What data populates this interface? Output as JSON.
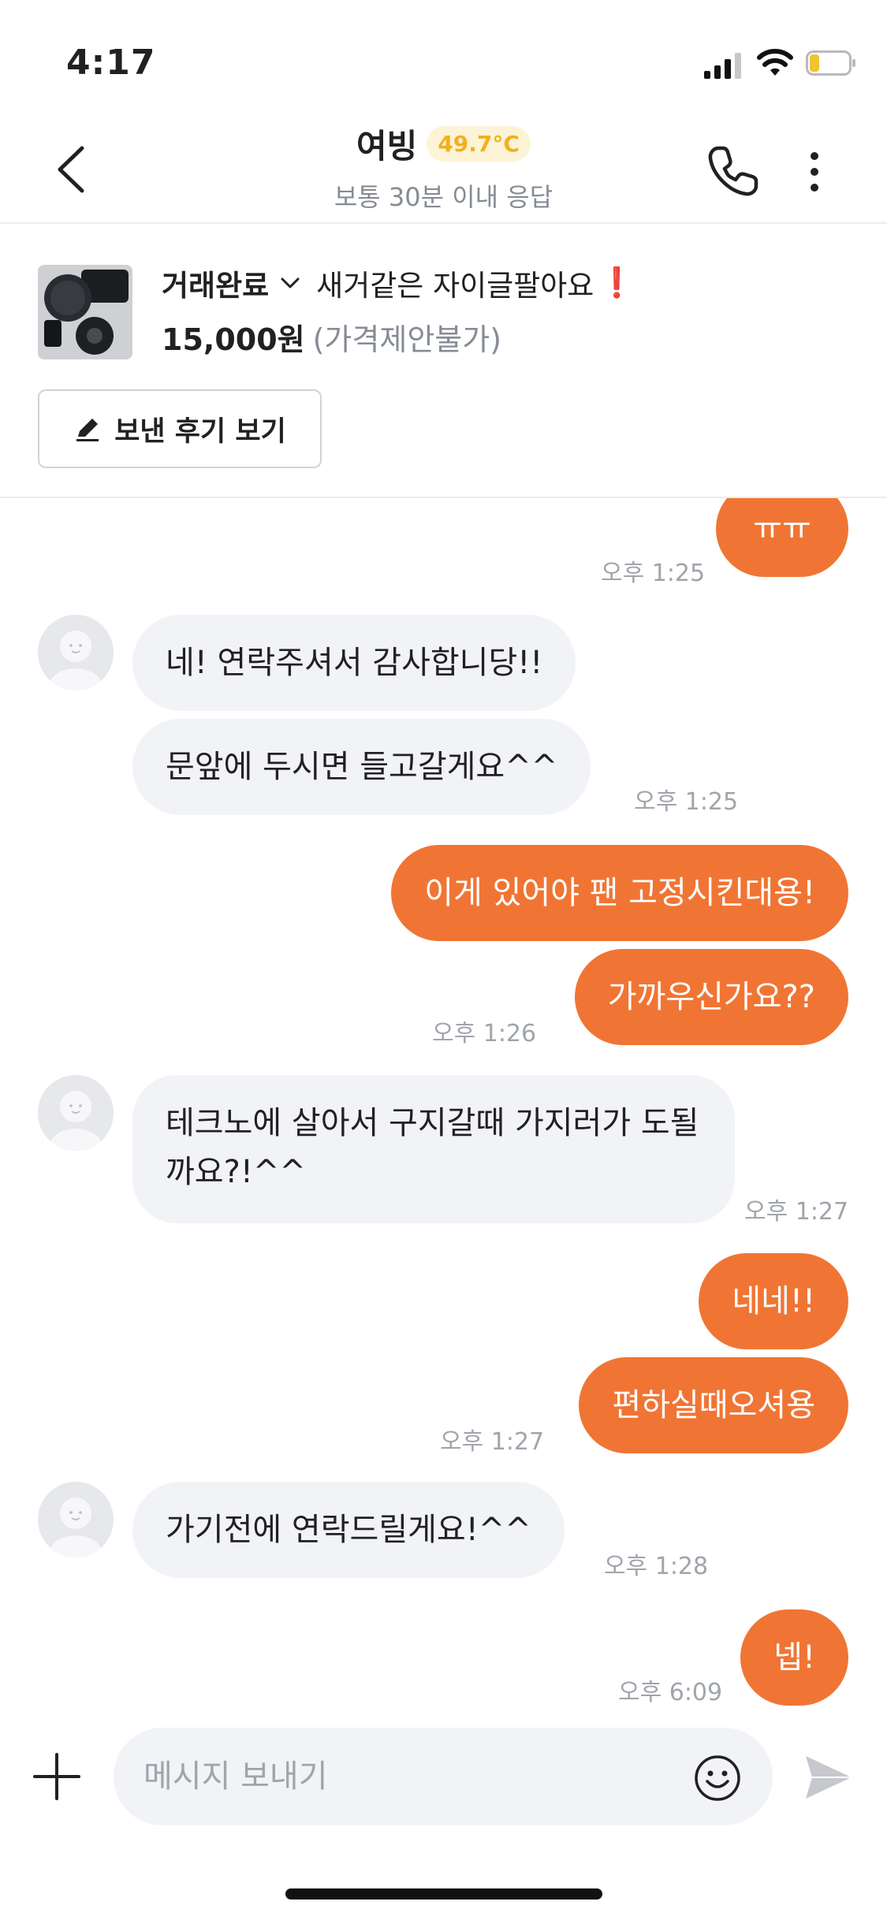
{
  "status_bar": {
    "time": "4:17"
  },
  "header": {
    "name": "여빙",
    "temperature": "49.7°C",
    "response": "보통 30분 이내 응답"
  },
  "product": {
    "status": "거래완료",
    "title": "새거같은 자이글팔아요",
    "exclaim": "❗",
    "price": "15,000원",
    "price_note": "(가격제안불가)",
    "review_button": "보낸 후기 보기"
  },
  "messages": [
    {
      "from": "me",
      "text": "ㅠㅠ",
      "time": "오후 1:25"
    },
    {
      "from": "them",
      "text": "네! 연락주셔서 감사합니당!!"
    },
    {
      "from": "them",
      "text": "문앞에 두시면 들고갈게요^^",
      "time": "오후 1:25"
    },
    {
      "from": "me",
      "text": "이게 있어야 팬 고정시킨대용!"
    },
    {
      "from": "me",
      "text": "가까우신가요??",
      "time": "오후 1:26"
    },
    {
      "from": "them",
      "text": "테크노에 살아서 구지갈때 가지러가 도될까요?!^^",
      "time": "오후 1:27"
    },
    {
      "from": "me",
      "text": "네네!!"
    },
    {
      "from": "me",
      "text": "편하실때오셔용",
      "time": "오후 1:27"
    },
    {
      "from": "them",
      "text": "가기전에 연락드릴게요!^^",
      "time": "오후 1:28"
    },
    {
      "from": "me",
      "text": "넵!",
      "time": "오후 6:09"
    }
  ],
  "input": {
    "placeholder": "메시지 보내기"
  },
  "colors": {
    "accent": "#f07534",
    "incoming_bubble": "#f2f3f6",
    "temperature": "#f2b01e"
  }
}
